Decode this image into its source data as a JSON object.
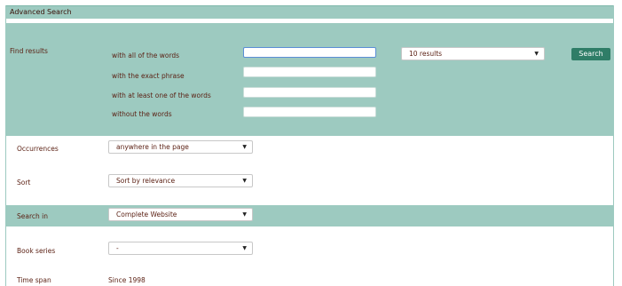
{
  "header": {
    "title": "Advanced Search"
  },
  "find": {
    "label": "Find results",
    "rows": [
      {
        "label": "with all of the words",
        "value": ""
      },
      {
        "label": "with the exact phrase",
        "value": ""
      },
      {
        "label": "with at least one of the words",
        "value": ""
      },
      {
        "label": "without the words",
        "value": ""
      }
    ],
    "results_select": "10 results",
    "search_button": "Search"
  },
  "occurrences": {
    "label": "Occurrences",
    "value": "anywhere in the page"
  },
  "sort": {
    "label": "Sort",
    "value": "Sort by relevance"
  },
  "search_in": {
    "label": "Search in",
    "value": "Complete Website"
  },
  "book_series": {
    "label": "Book series",
    "value": "-"
  },
  "time_span": {
    "label": "Time span",
    "value": "Since 1998"
  },
  "colors": {
    "panel": "#9dcac0",
    "button": "#2f7d67",
    "text": "#5a1f12"
  }
}
